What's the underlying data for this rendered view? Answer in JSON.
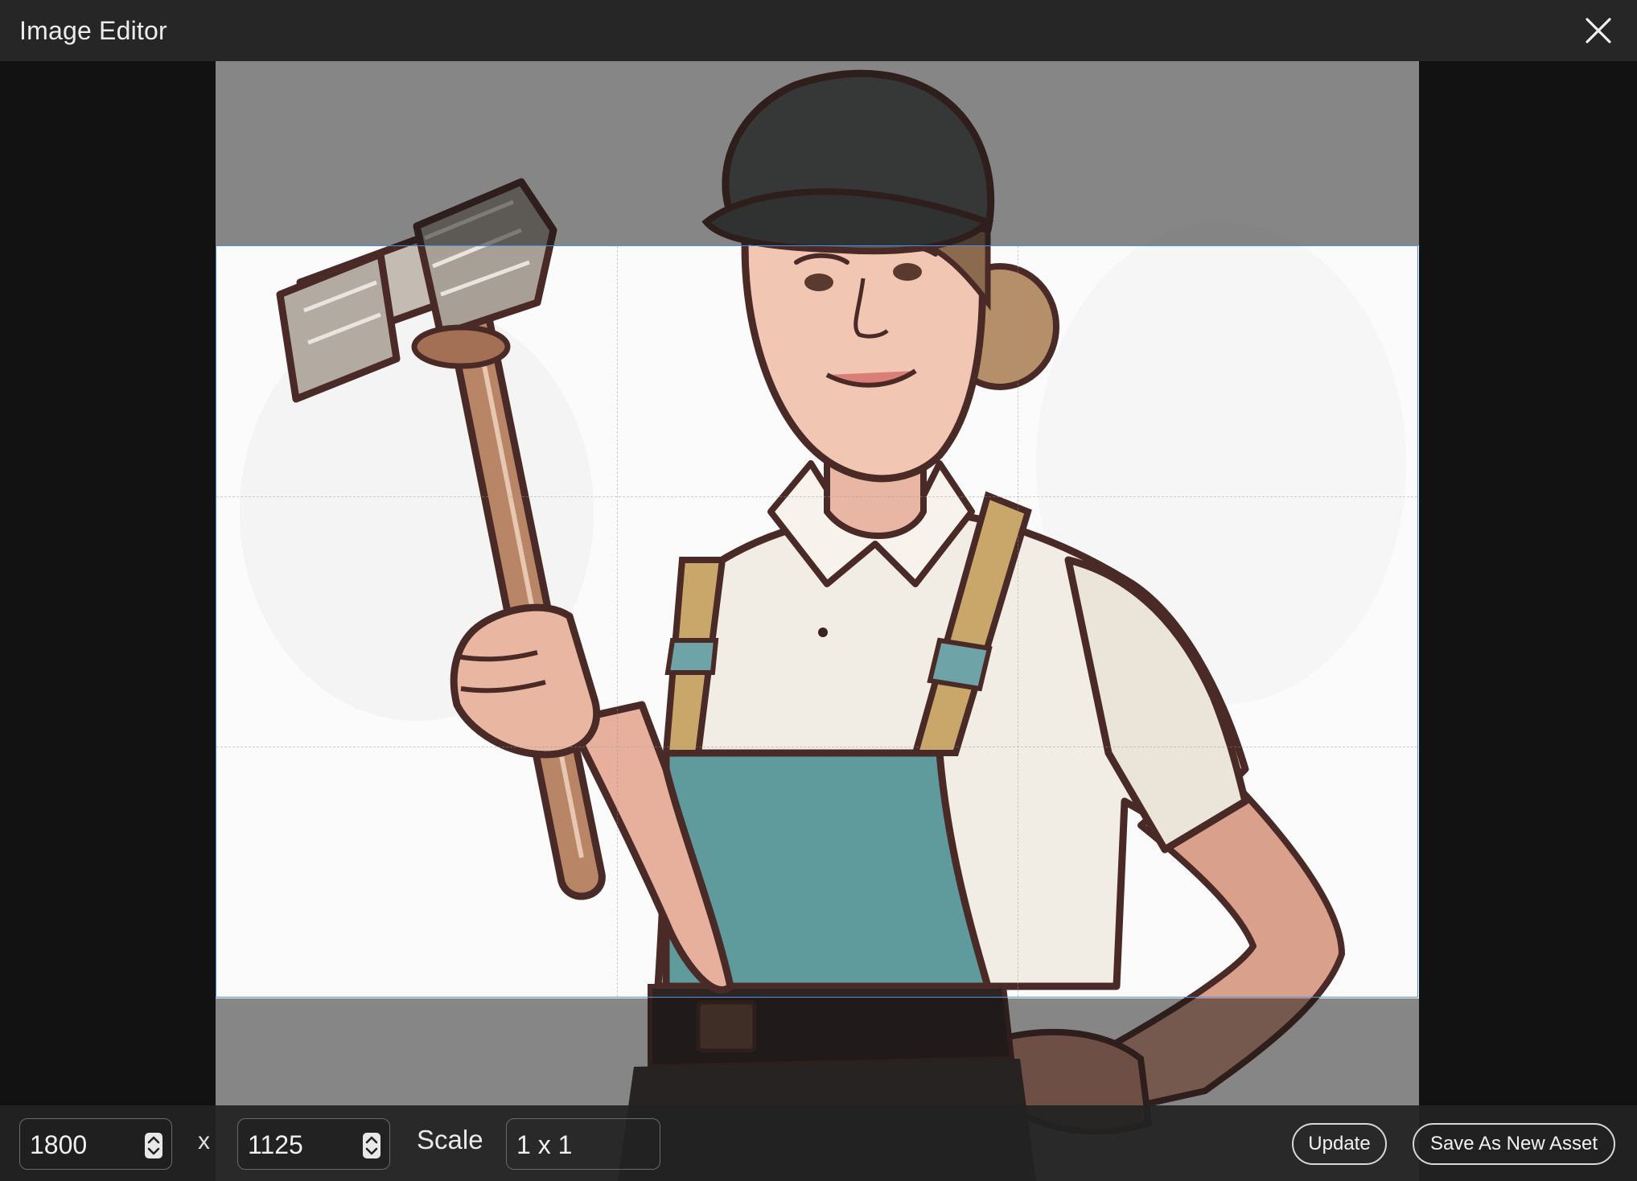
{
  "window": {
    "title": "Image Editor",
    "close_icon": "close-icon"
  },
  "image": {
    "description_icon": "worker-illustration",
    "accent_colors": {
      "crop_border": "#4a8fe0",
      "cap": "#5b5f5d",
      "overalls": "#5f9a9c",
      "shirt": "#f1ece4",
      "hammer_handle": "#b88566",
      "outline": "#4a2a27"
    }
  },
  "toolbar": {
    "width_value": "1800",
    "height_value": "1125",
    "separator": "x",
    "scale_label": "Scale",
    "scale_value": "1 x 1",
    "update_label": "Update",
    "save_label": "Save As New Asset",
    "stepper_icon": "stepper-icon"
  }
}
